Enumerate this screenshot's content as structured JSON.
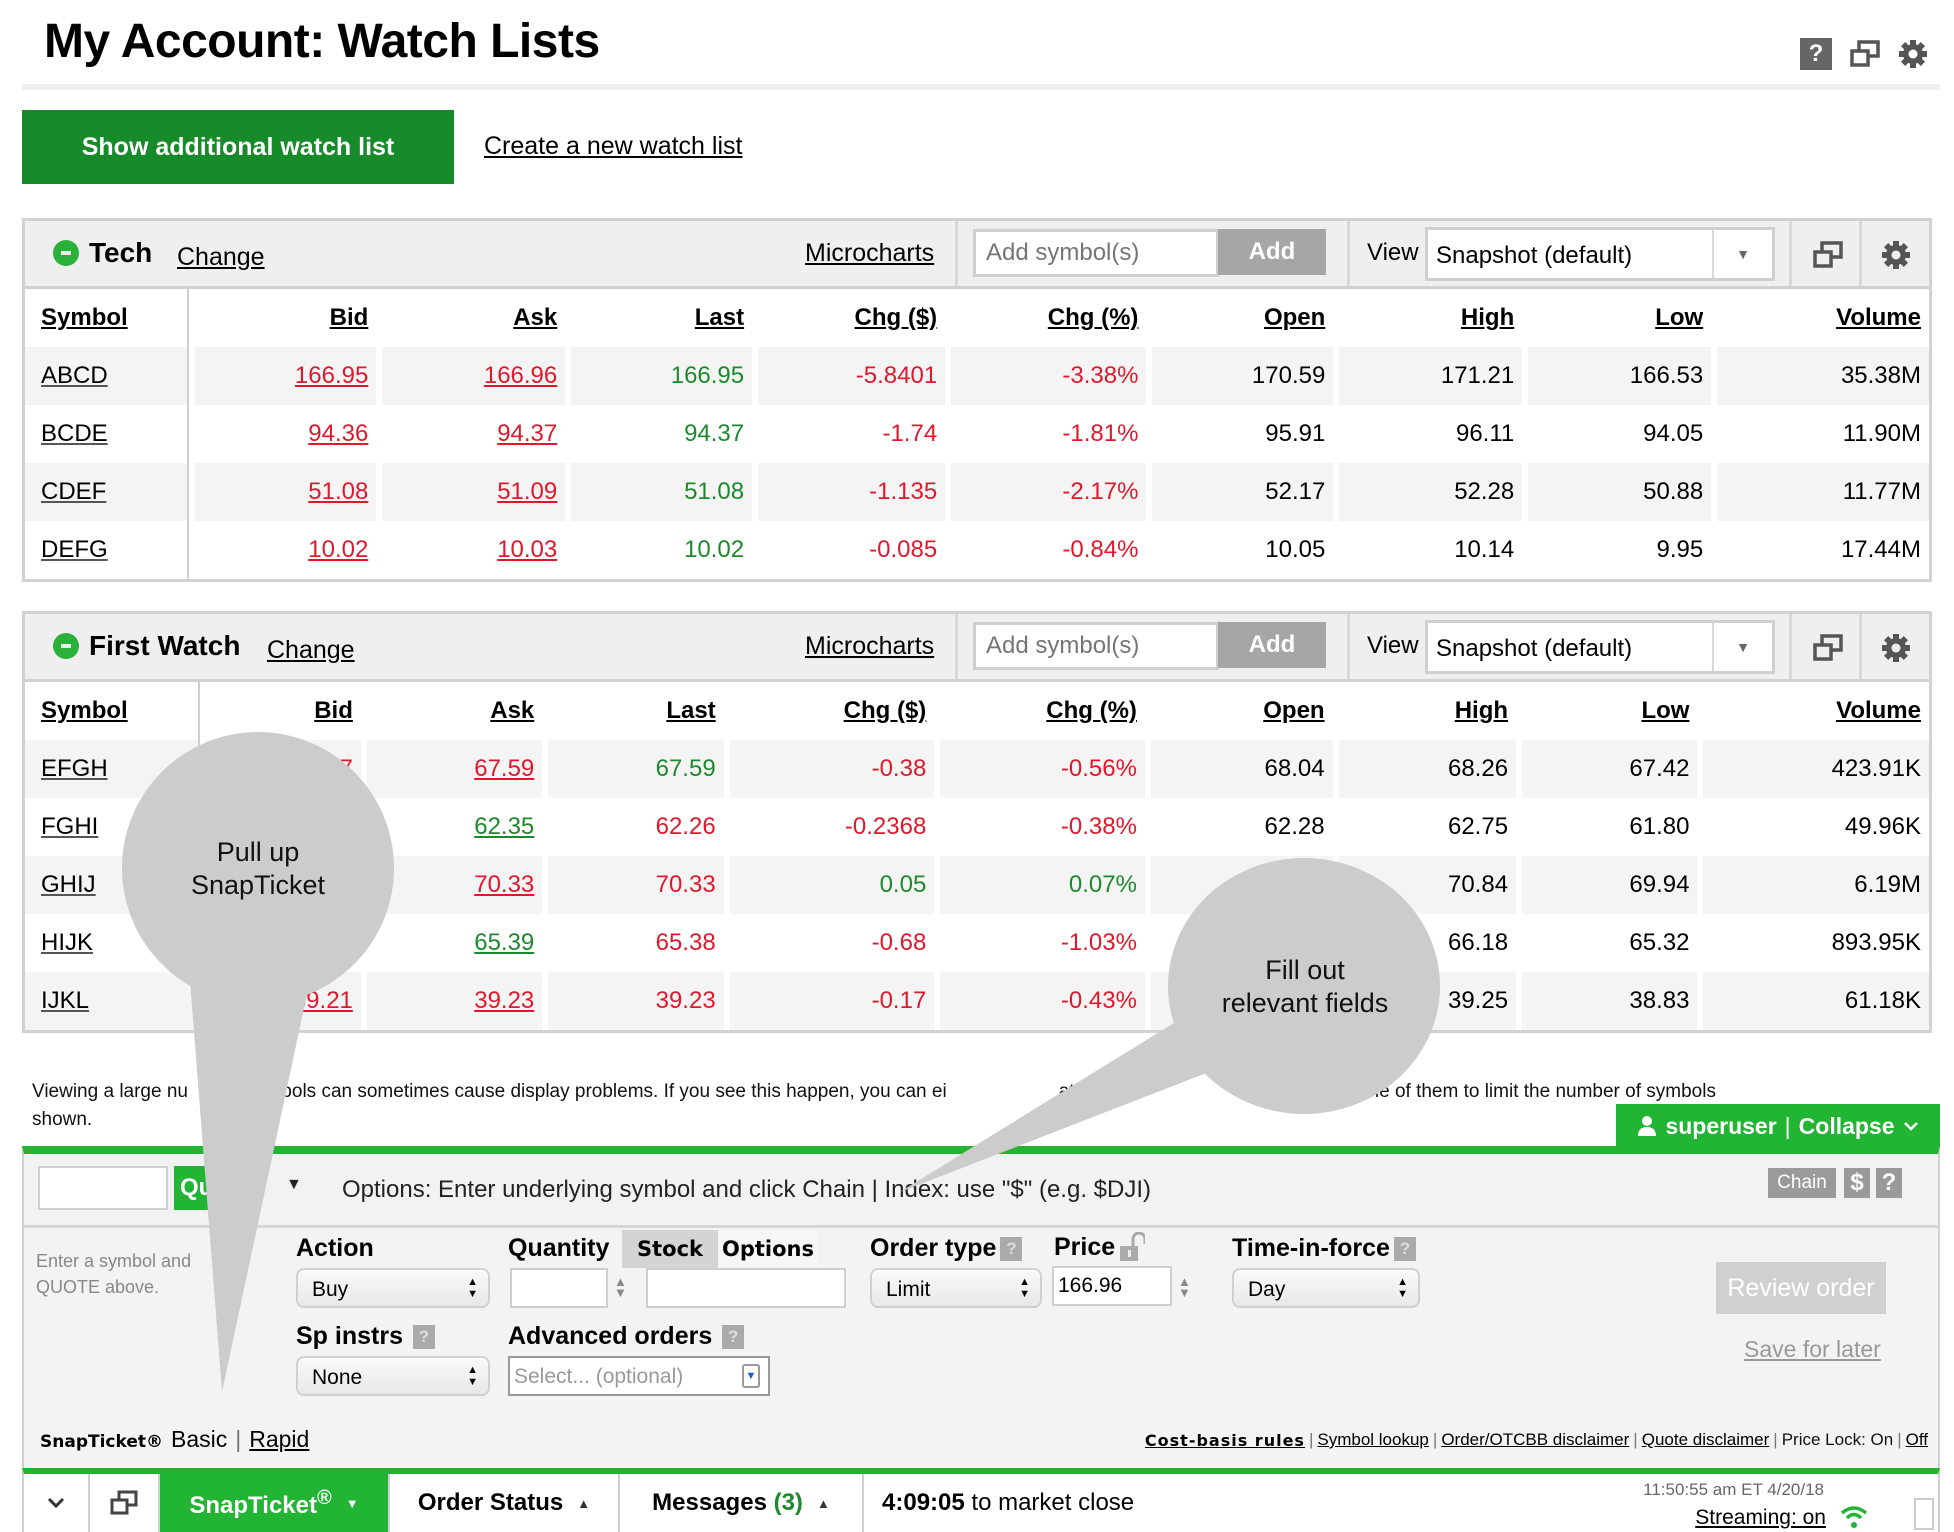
{
  "header": {
    "title": "My Account: Watch Lists",
    "icons": [
      "help-icon",
      "popout-icon",
      "gear-icon"
    ],
    "help_glyph": "?"
  },
  "actions": {
    "show_additional": "Show additional watch list",
    "create_new": "Create a new watch list"
  },
  "watchlist_common": {
    "change_label": "Change",
    "microcharts_label": "Microcharts",
    "add_placeholder": "Add symbol(s)",
    "add_button": "Add",
    "view_label": "View",
    "view_selected": "Snapshot (default)",
    "columns": [
      "Symbol",
      "Bid",
      "Ask",
      "Last",
      "Chg ($)",
      "Chg (%)",
      "Open",
      "High",
      "Low",
      "Volume"
    ]
  },
  "watchlists": [
    {
      "name": "Tech",
      "rows": [
        {
          "symbol": "ABCD",
          "bid": "166.95",
          "ask": "166.96",
          "last": "166.95",
          "chg": "-5.8401",
          "chg_pct": "-3.38%",
          "open": "170.59",
          "high": "171.21",
          "low": "166.53",
          "volume": "35.38M",
          "bid_color": "red",
          "ask_color": "red",
          "last_color": "green",
          "chg_color": "red"
        },
        {
          "symbol": "BCDE",
          "bid": "94.36",
          "ask": "94.37",
          "last": "94.37",
          "chg": "-1.74",
          "chg_pct": "-1.81%",
          "open": "95.91",
          "high": "96.11",
          "low": "94.05",
          "volume": "11.90M",
          "bid_color": "red",
          "ask_color": "red",
          "last_color": "green",
          "chg_color": "red"
        },
        {
          "symbol": "CDEF",
          "bid": "51.08",
          "ask": "51.09",
          "last": "51.08",
          "chg": "-1.135",
          "chg_pct": "-2.17%",
          "open": "52.17",
          "high": "52.28",
          "low": "50.88",
          "volume": "11.77M",
          "bid_color": "red",
          "ask_color": "red",
          "last_color": "green",
          "chg_color": "red"
        },
        {
          "symbol": "DEFG",
          "bid": "10.02",
          "ask": "10.03",
          "last": "10.02",
          "chg": "-0.085",
          "chg_pct": "-0.84%",
          "open": "10.05",
          "high": "10.14",
          "low": "9.95",
          "volume": "17.44M",
          "bid_color": "red",
          "ask_color": "red",
          "last_color": "green",
          "chg_color": "red"
        }
      ]
    },
    {
      "name": "First Watch",
      "rows": [
        {
          "symbol": "EFGH",
          "bid": "57",
          "ask": "67.59",
          "last": "67.59",
          "chg": "-0.38",
          "chg_pct": "-0.56%",
          "open": "68.04",
          "high": "68.26",
          "low": "67.42",
          "volume": "423.91K",
          "bid_color": "red",
          "ask_color": "red",
          "last_color": "green",
          "chg_color": "red"
        },
        {
          "symbol": "FGHI",
          "bid": "",
          "ask": "62.35",
          "last": "62.26",
          "chg": "-0.2368",
          "chg_pct": "-0.38%",
          "open": "62.28",
          "high": "62.75",
          "low": "61.80",
          "volume": "49.96K",
          "bid_color": "green",
          "ask_color": "green",
          "last_color": "red",
          "chg_color": "red"
        },
        {
          "symbol": "GHIJ",
          "bid": "",
          "ask": "70.33",
          "last": "70.33",
          "chg": "0.05",
          "chg_pct": "0.07%",
          "open": "",
          "high": "70.84",
          "low": "69.94",
          "volume": "6.19M",
          "bid_color": "red",
          "ask_color": "red",
          "last_color": "red",
          "chg_color": "green"
        },
        {
          "symbol": "HIJK",
          "bid": "",
          "ask": "65.39",
          "last": "65.38",
          "chg": "-0.68",
          "chg_pct": "-1.03%",
          "open": "",
          "high": "66.18",
          "low": "65.32",
          "volume": "893.95K",
          "bid_color": "green",
          "ask_color": "green",
          "last_color": "red",
          "chg_color": "red"
        },
        {
          "symbol": "IJKL",
          "bid": "39.21",
          "ask": "39.23",
          "last": "39.23",
          "chg": "-0.17",
          "chg_pct": "-0.43%",
          "open": "",
          "high": "39.25",
          "low": "38.83",
          "volume": "61.18K",
          "bid_color": "red",
          "ask_color": "red",
          "last_color": "red",
          "chg_color": "red"
        }
      ]
    }
  ],
  "notice": "Viewing a large number of symbols can sometimes cause display problems. If you see this happen, you can either close watch lists or collapse some of them to limit the number of symbols shown.",
  "notice_visible_left": "Viewing a large nu",
  "notice_visible_mid": "ymbols can sometimes cause display problems. If you see this happen, you can ei",
  "notice_visible_mid2": "atch lists",
  "notice_visible_right": "r collapse some of them to limit the number of symbols",
  "notice_visible_end": "shown.",
  "user_bar": {
    "username": "superuser",
    "separator": "|",
    "collapse": "Collapse"
  },
  "snapticket": {
    "quote_button": "Qu",
    "options_hint": "Options: Enter underlying symbol and click Chain | Index: use \"$\" (e.g. $DJI)",
    "chain_button": "Chain",
    "dollar_button": "$",
    "help_button": "?",
    "left_hint_line1": "Enter a symbol and",
    "left_hint_line2": "QUOTE above.",
    "action_label": "Action",
    "action_value": "Buy",
    "quantity_label": "Quantity",
    "quantity_value": "",
    "segment_stock": "Stock",
    "segment_options": "Options",
    "order_type_label": "Order type",
    "order_type_value": "Limit",
    "price_label": "Price",
    "price_value": "166.96",
    "tif_label": "Time-in-force",
    "tif_value": "Day",
    "sp_instrs_label": "Sp instrs",
    "sp_instrs_value": "None",
    "advanced_label": "Advanced orders",
    "advanced_placeholder": "Select... (optional)",
    "review_button": "Review order",
    "save_later": "Save for later",
    "brand": "SnapTicket®",
    "mode_basic": "Basic",
    "mode_rapid": "Rapid",
    "links": [
      "Cost-basis rules",
      "Symbol lookup",
      "Order/OTCBB disclaimer",
      "Quote disclaimer"
    ],
    "price_lock_text": "Price Lock: On",
    "price_lock_off": "Off"
  },
  "bottom_bar": {
    "snapticket_tab": "SnapTicket",
    "snapticket_reg": "®",
    "order_status_tab": "Order Status",
    "messages_tab": "Messages",
    "messages_count": "(3)",
    "countdown": "4:09:05",
    "countdown_suffix": "to market close",
    "timestamp": "11:50:55 am ET 4/20/18",
    "streaming": "Streaming: on"
  },
  "annotations": {
    "bubble1": [
      "Pull up",
      "SnapTicket"
    ],
    "bubble2": [
      "Fill out",
      "relevant fields"
    ]
  },
  "colors": {
    "brand_green": "#22b433",
    "button_green": "#178a2a",
    "negative": "#e0182c",
    "positive": "#1c8a2c",
    "bubble": "#cccccc"
  }
}
